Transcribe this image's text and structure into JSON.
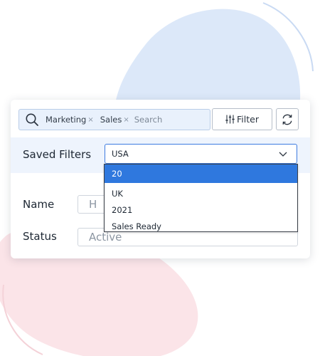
{
  "search": {
    "chips": [
      {
        "label": "Marketing",
        "remove": "×"
      },
      {
        "label": "Sales",
        "remove": "×"
      }
    ],
    "placeholder": "Search"
  },
  "toolbar": {
    "filter_label": "Filter",
    "filter_icon": "sliders-icon",
    "refresh_icon": "refresh-icon"
  },
  "saved_filters": {
    "label": "Saved Filters",
    "selected": "USA",
    "options": [
      "20",
      "UK",
      "2021",
      "Sales Ready"
    ],
    "highlighted_option": "20"
  },
  "fields": {
    "name": {
      "label": "Name",
      "value": "H"
    },
    "status": {
      "label": "Status",
      "value": "Active"
    }
  },
  "colors": {
    "accent": "#2f78de",
    "search_bg": "#e9f1fc",
    "row_bg": "#eef4fd",
    "blob_blue": "#dce8f9",
    "blob_pink": "#fbe4e8"
  }
}
